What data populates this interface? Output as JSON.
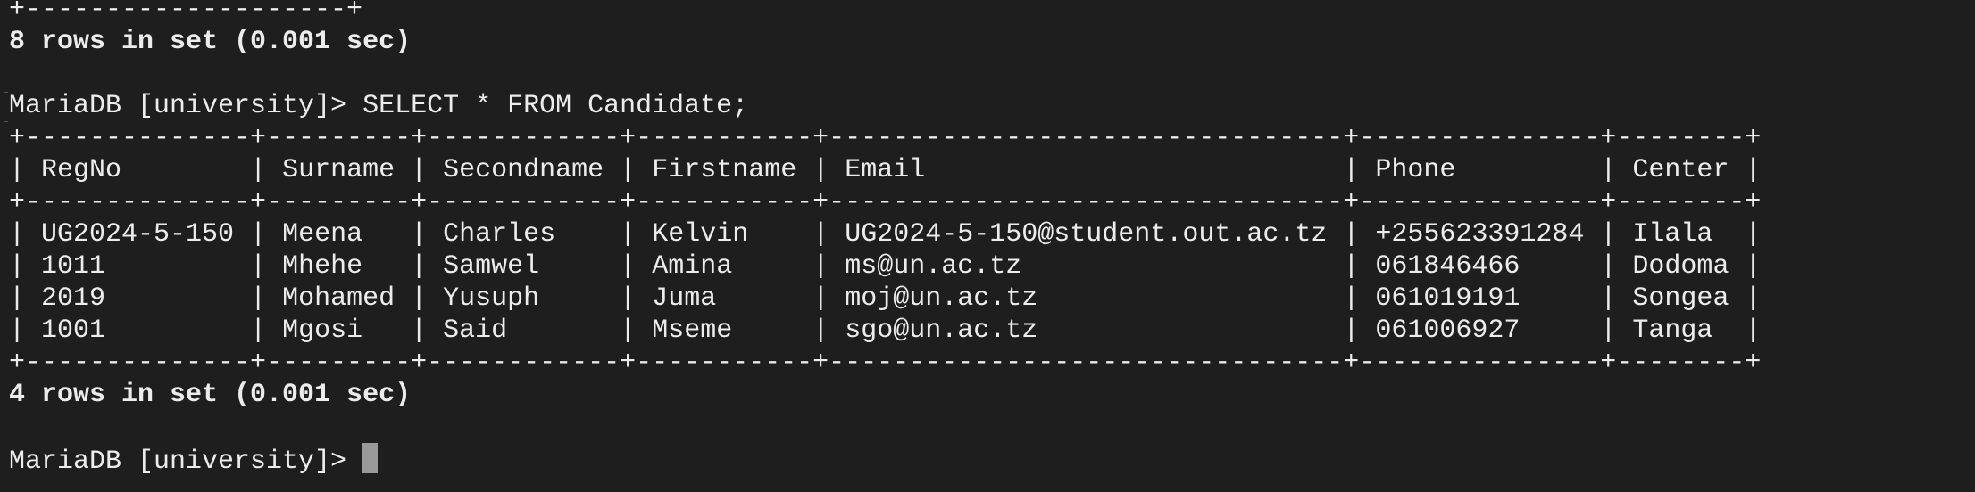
{
  "terminal": {
    "prev_border_width": 20,
    "prev_status": "8 rows in set (0.001 sec)",
    "prompt": "MariaDB [university]> ",
    "command": "SELECT * FROM Candidate;",
    "status": "4 rows in set (0.001 sec)",
    "final_prompt": "MariaDB [university]> "
  },
  "table": {
    "columns": [
      "RegNo",
      "Surname",
      "Secondname",
      "Firstname",
      "Email",
      "Phone",
      "Center"
    ],
    "rows": [
      [
        "UG2024-5-150",
        "Meena",
        "Charles",
        "Kelvin",
        "UG2024-5-150@student.out.ac.tz",
        "+255623391284",
        "Ilala"
      ],
      [
        "1011",
        "Mhehe",
        "Samwel",
        "Amina",
        "ms@un.ac.tz",
        "061846466",
        "Dodoma"
      ],
      [
        "2019",
        "Mohamed",
        "Yusuph",
        "Juma",
        "moj@un.ac.tz",
        "061019191",
        "Songea"
      ],
      [
        "1001",
        "Mgosi",
        "Said",
        "Mseme",
        "sgo@un.ac.tz",
        "061006927",
        "Tanga"
      ]
    ]
  }
}
